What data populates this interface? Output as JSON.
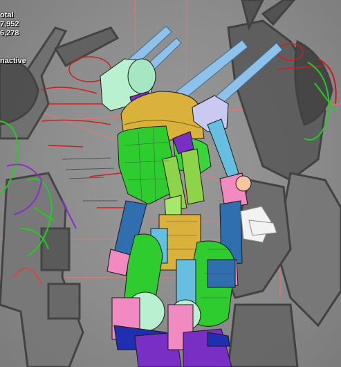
{
  "viewport": {
    "stats": {
      "line1": "otal",
      "line2": "7,952",
      "line3": "6,278"
    },
    "status_text": "nactive"
  },
  "colors": {
    "background": "#8a8a8a",
    "sketch": "#3c3c3c",
    "guide_line": "#ff6a6a",
    "annotation": "#cc1f1f",
    "green_wire": "#22cc22",
    "torso_gold": "#d9b13b",
    "body_green": "#2fcc2f",
    "arm_blue": "#2f6fb0",
    "limb_cyan": "#66bfe0",
    "head_mint": "#b9f0cf",
    "accent_purple": "#7a2fc4",
    "pink": "#f08ac0",
    "lavender": "#c9c9f2"
  },
  "icons": [
    "robot-model",
    "concept-sketch"
  ]
}
